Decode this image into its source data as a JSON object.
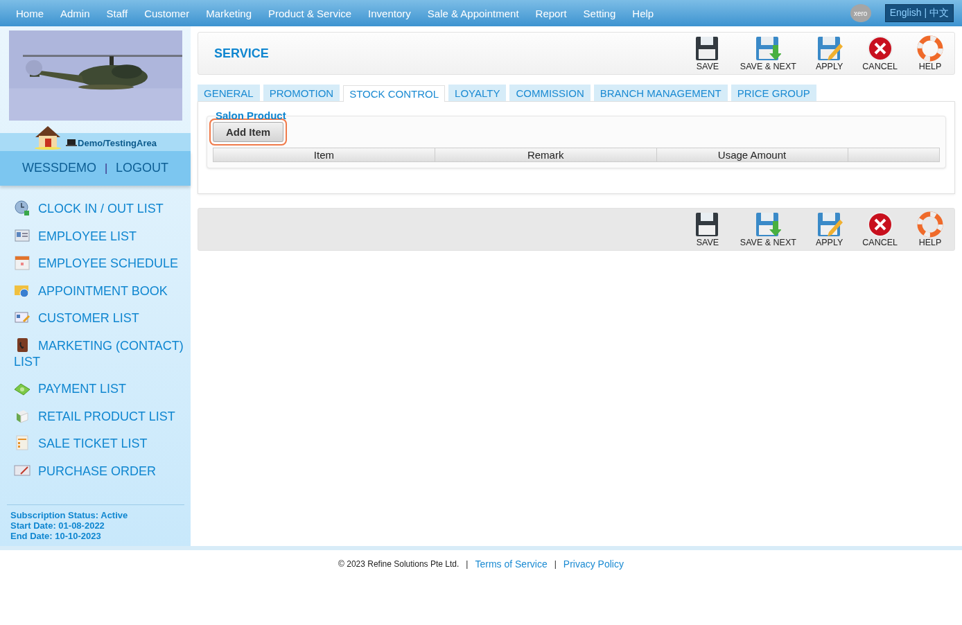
{
  "nav": {
    "items": [
      "Home",
      "Admin",
      "Staff",
      "Customer",
      "Marketing",
      "Product & Service",
      "Inventory",
      "Sale & Appointment",
      "Report",
      "Setting",
      "Help"
    ],
    "xero": "xero",
    "language": "English",
    "language_separator": "|",
    "language_alt": "中文"
  },
  "sidebar": {
    "area": "Demo/TestingArea",
    "user": "WESSDEMO",
    "separator": "|",
    "logout": "LOGOUT",
    "items": [
      "CLOCK IN / OUT LIST",
      "EMPLOYEE LIST",
      "EMPLOYEE SCHEDULE",
      "APPOINTMENT BOOK",
      "CUSTOMER LIST",
      "MARKETING (CONTACT) LIST",
      "PAYMENT LIST",
      "RETAIL PRODUCT LIST",
      "SALE TICKET LIST",
      "PURCHASE ORDER"
    ],
    "subscription": [
      "Subscription Status: Active",
      "Start Date: 01-08-2022",
      "End Date: 10-10-2023"
    ]
  },
  "header": {
    "title": "SERVICE"
  },
  "toolbar_top": [
    "SAVE",
    "SAVE & NEXT",
    "APPLY",
    "CANCEL",
    "HELP"
  ],
  "tabs": [
    {
      "label": "GENERAL",
      "selected": false
    },
    {
      "label": "PROMOTION",
      "selected": false
    },
    {
      "label": "STOCK CONTROL",
      "selected": true
    },
    {
      "label": "LOYALTY",
      "selected": false
    },
    {
      "label": "COMMISSION",
      "selected": false
    },
    {
      "label": "BRANCH MANAGEMENT",
      "selected": false
    },
    {
      "label": "PRICE GROUP",
      "selected": false
    }
  ],
  "section": {
    "legend": "Salon Product",
    "add_button": "Add Item",
    "columns": [
      "Item",
      "Remark",
      "Usage Amount"
    ]
  },
  "toolbar_bottom": [
    "SAVE",
    "SAVE & NEXT",
    "APPLY",
    "CANCEL",
    "HELP"
  ],
  "footer": {
    "copyright": "© 2023 Refine Solutions Pte Ltd.",
    "separator_1": "|",
    "terms": "Terms of Service",
    "separator_2": "|",
    "privacy": "Privacy Policy"
  }
}
